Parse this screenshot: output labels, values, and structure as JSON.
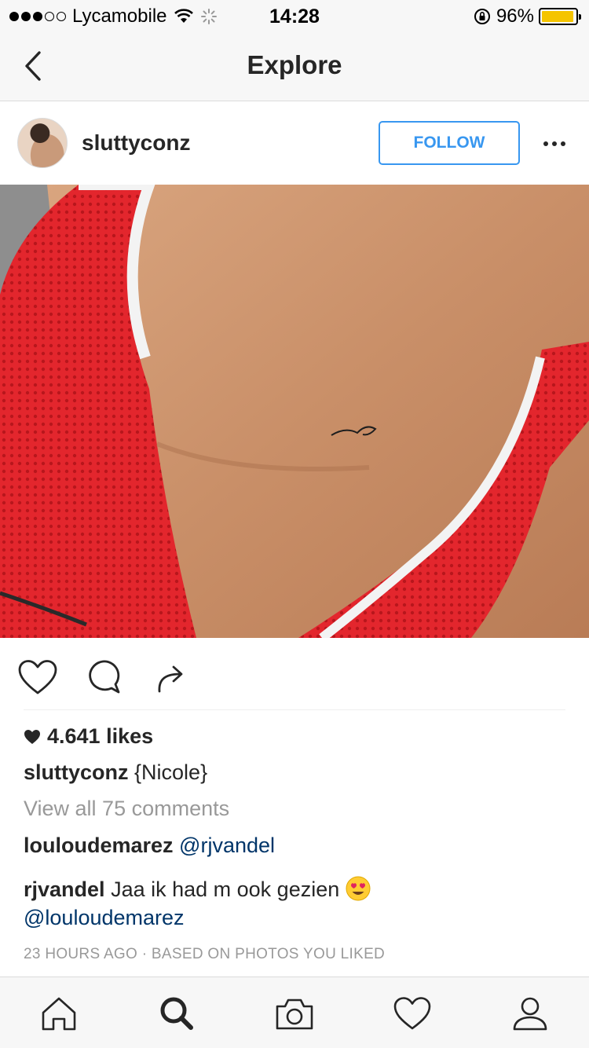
{
  "status_bar": {
    "carrier": "Lycamobile",
    "time": "14:28",
    "battery_percent": "96%",
    "battery_level": 0.96,
    "signal_bars_filled": 3,
    "signal_bars_total": 5
  },
  "nav": {
    "title": "Explore",
    "back_icon": "chevron-left-icon"
  },
  "post": {
    "username": "sluttyconz",
    "follow_label": "FOLLOW",
    "more_icon": "ellipsis-icon",
    "likes": "4.641 likes",
    "caption": {
      "username": "sluttyconz",
      "text": "{Nicole}"
    },
    "view_all_comments": "View all 75 comments",
    "comments": [
      {
        "username": "louloudemarez",
        "text": "",
        "mention": "@rjvandel"
      },
      {
        "username": "rjvandel",
        "text": "Jaa ik had m ook gezien",
        "mention": "@louloudemarez",
        "emoji": "heart-eyes-emoji"
      }
    ],
    "timestamp": "23 HOURS AGO",
    "reason": "BASED ON PHOTOS YOU LIKED",
    "separator": "·"
  },
  "colors": {
    "accent": "#3897f0",
    "mention": "#003569",
    "muted": "#999999",
    "text": "#262626",
    "battery": "#f5c400"
  },
  "tabs": [
    {
      "name": "home",
      "icon": "home-icon"
    },
    {
      "name": "search",
      "icon": "search-icon",
      "active": true
    },
    {
      "name": "camera",
      "icon": "camera-icon"
    },
    {
      "name": "activity",
      "icon": "heart-icon"
    },
    {
      "name": "profile",
      "icon": "profile-icon"
    }
  ]
}
